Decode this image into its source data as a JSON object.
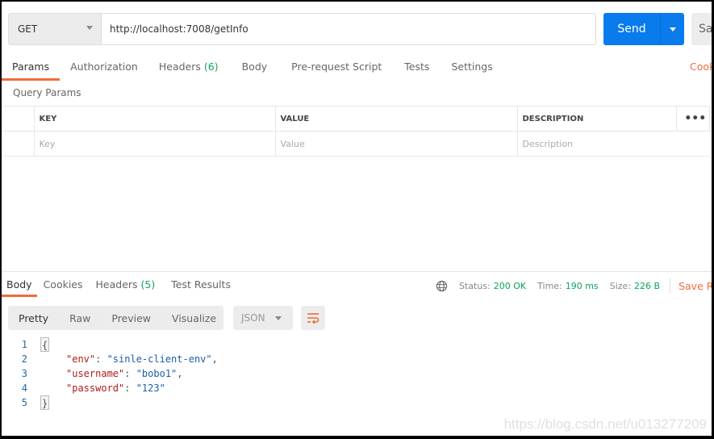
{
  "request": {
    "method": "GET",
    "url": "http://localhost:7008/getInfo",
    "send_label": "Send",
    "save_label": "Save"
  },
  "tabs": [
    {
      "label": "Params"
    },
    {
      "label": "Authorization"
    },
    {
      "label": "Headers",
      "count": "(6)"
    },
    {
      "label": "Body"
    },
    {
      "label": "Pre-request Script"
    },
    {
      "label": "Tests"
    },
    {
      "label": "Settings"
    }
  ],
  "cookies_link": "Cookies",
  "query_params": {
    "title": "Query Params",
    "headers": [
      "KEY",
      "VALUE",
      "DESCRIPTION"
    ],
    "placeholders": [
      "Key",
      "Value",
      "Description"
    ]
  },
  "response": {
    "tabs": [
      {
        "label": "Body"
      },
      {
        "label": "Cookies"
      },
      {
        "label": "Headers",
        "count": "(5)"
      },
      {
        "label": "Test Results"
      }
    ],
    "status_label": "Status:",
    "status": "200 OK",
    "time_label": "Time:",
    "time": "190 ms",
    "size_label": "Size:",
    "size": "226 B",
    "save_label": "Save Response",
    "views": [
      "Pretty",
      "Raw",
      "Preview",
      "Visualize"
    ],
    "format": "JSON",
    "lines": [
      {
        "n": "1",
        "open": "{"
      },
      {
        "n": "2",
        "key": "\"env\"",
        "value": "\"sinle-client-env\"",
        "comma": ","
      },
      {
        "n": "3",
        "key": "\"username\"",
        "value": "\"bobo1\"",
        "comma": ","
      },
      {
        "n": "4",
        "key": "\"password\"",
        "value": "\"123\"",
        "comma": ""
      },
      {
        "n": "5",
        "close": "}"
      }
    ]
  },
  "watermark": "https://blog.csdn.net/u013277209",
  "colors": {
    "accent": "#f26b3a",
    "send": "#097bed",
    "success": "#0ca35f"
  }
}
